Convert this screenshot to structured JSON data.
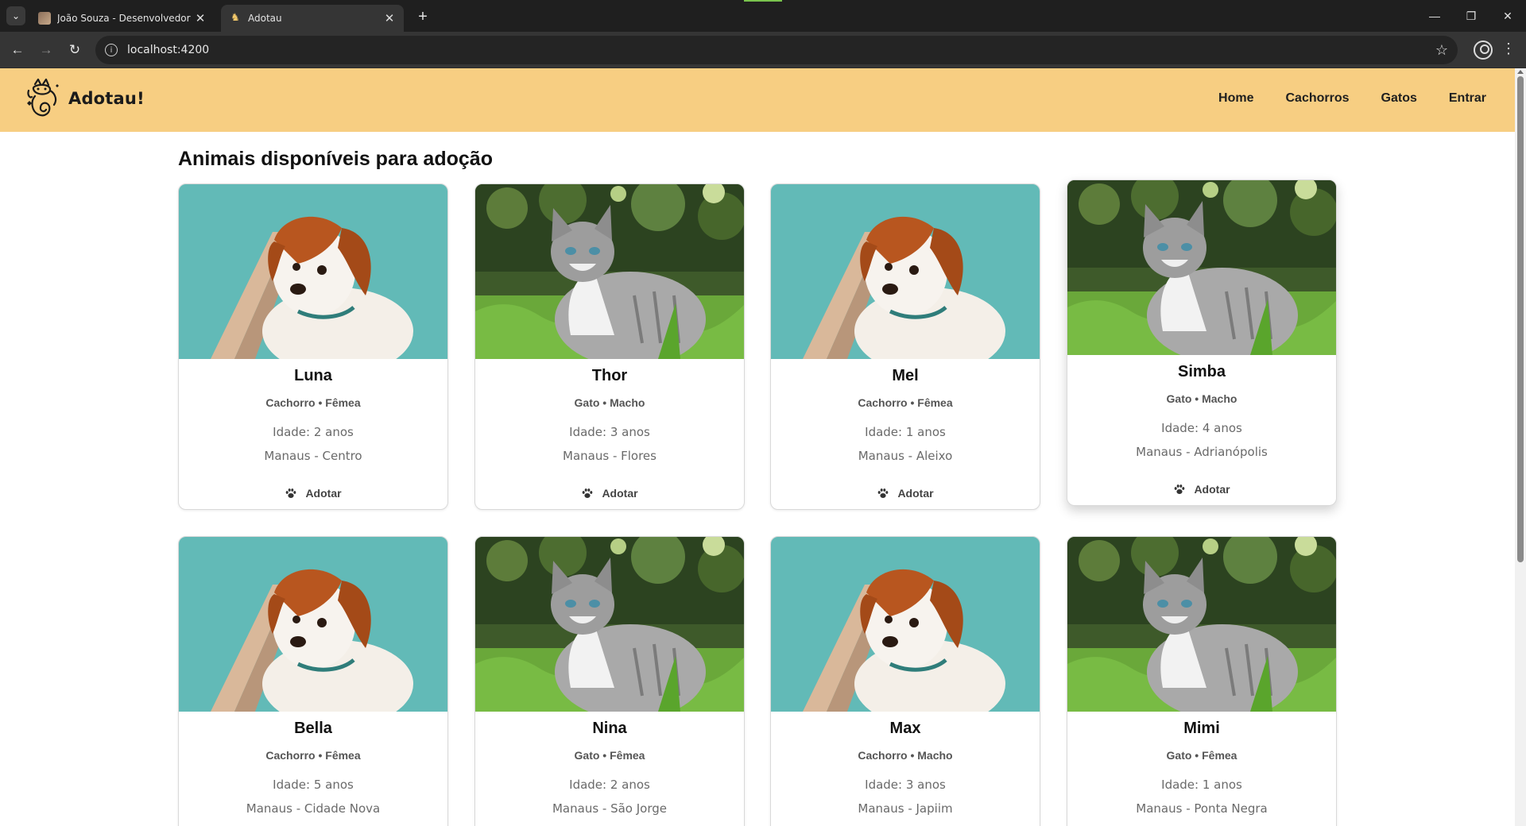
{
  "browser": {
    "tabs": [
      {
        "title": "João Souza - Desenvolvedor Fu",
        "active": false
      },
      {
        "title": "Adotau",
        "active": true
      }
    ],
    "url": "localhost:4200"
  },
  "site": {
    "brand": "Adotau!",
    "nav": [
      "Home",
      "Cachorros",
      "Gatos",
      "Entrar"
    ],
    "accent_color": "#f7ce82"
  },
  "page": {
    "title": "Animais disponíveis para adoção",
    "adopt_label": "Adotar",
    "pets": [
      {
        "name": "Luna",
        "meta": "Cachorro • Fêmea",
        "age": "Idade: 2 anos",
        "location": "Manaus - Centro",
        "kind": "dog"
      },
      {
        "name": "Thor",
        "meta": "Gato • Macho",
        "age": "Idade: 3 anos",
        "location": "Manaus - Flores",
        "kind": "cat"
      },
      {
        "name": "Mel",
        "meta": "Cachorro • Fêmea",
        "age": "Idade: 1 anos",
        "location": "Manaus - Aleixo",
        "kind": "dog"
      },
      {
        "name": "Simba",
        "meta": "Gato • Macho",
        "age": "Idade: 4 anos",
        "location": "Manaus - Adrianópolis",
        "kind": "cat"
      },
      {
        "name": "Bella",
        "meta": "Cachorro • Fêmea",
        "age": "Idade: 5 anos",
        "location": "Manaus - Cidade Nova",
        "kind": "dog"
      },
      {
        "name": "Nina",
        "meta": "Gato • Fêmea",
        "age": "Idade: 2 anos",
        "location": "Manaus - São Jorge",
        "kind": "cat"
      },
      {
        "name": "Max",
        "meta": "Cachorro • Macho",
        "age": "Idade: 3 anos",
        "location": "Manaus - Japiim",
        "kind": "dog"
      },
      {
        "name": "Mimi",
        "meta": "Gato • Fêmea",
        "age": "Idade: 1 anos",
        "location": "Manaus - Ponta Negra",
        "kind": "cat"
      }
    ]
  }
}
